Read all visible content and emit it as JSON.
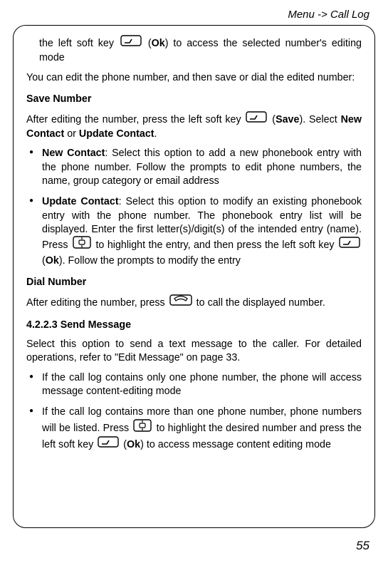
{
  "header": {
    "path": "Menu -> Call Log"
  },
  "intro": {
    "line1_pre": "the left soft key ",
    "line1_post_a": " (",
    "line1_ok": "Ok",
    "line1_post_b": ") to access the selected number's editing mode",
    "line2": "You can edit the phone number, and then save or dial the edited number:"
  },
  "save_number": {
    "heading": "Save Number",
    "para_pre": "After editing the number, press the left soft key ",
    "para_post_a": " (",
    "para_save": "Save",
    "para_post_b": "). Select ",
    "new_contact_word": "New Contact",
    "or_word": " or ",
    "update_contact_word": "Update Contact",
    "period": ".",
    "bullets": {
      "new": {
        "label": "New Contact",
        "text": ": Select this option to add a new phonebook entry with the phone number. Follow the prompts to edit phone numbers, the name, group category or email address"
      },
      "update": {
        "label": "Update Contact",
        "text_a": ": Select this option to modify an existing phonebook entry with the phone number. The phonebook entry list will be displayed. Enter the first letter(s)/digit(s) of the intended entry (name). Press ",
        "text_b": " to highlight the entry, and then press the left soft key ",
        "text_c_a": " (",
        "ok": "Ok",
        "text_c_b": "). Follow the prompts to modify the entry"
      }
    }
  },
  "dial_number": {
    "heading": "Dial Number",
    "para_pre": "After editing the number, press ",
    "para_post": " to call the displayed number."
  },
  "send_message": {
    "heading": "4.2.2.3 Send Message",
    "para": "Select this option to send a text message to the caller. For detailed operations, refer to \"Edit Message\" on page 33.",
    "bullets": {
      "one": "If the call log contains only one phone number, the phone will access message content-editing mode",
      "two_a": "If the call log contains more than one phone number, phone numbers will be listed. Press ",
      "two_b": " to highlight the desired number and press the left soft key ",
      "two_c_a": " (",
      "two_ok": "Ok",
      "two_c_b": ") to access message content editing mode"
    }
  },
  "page_number": "55"
}
